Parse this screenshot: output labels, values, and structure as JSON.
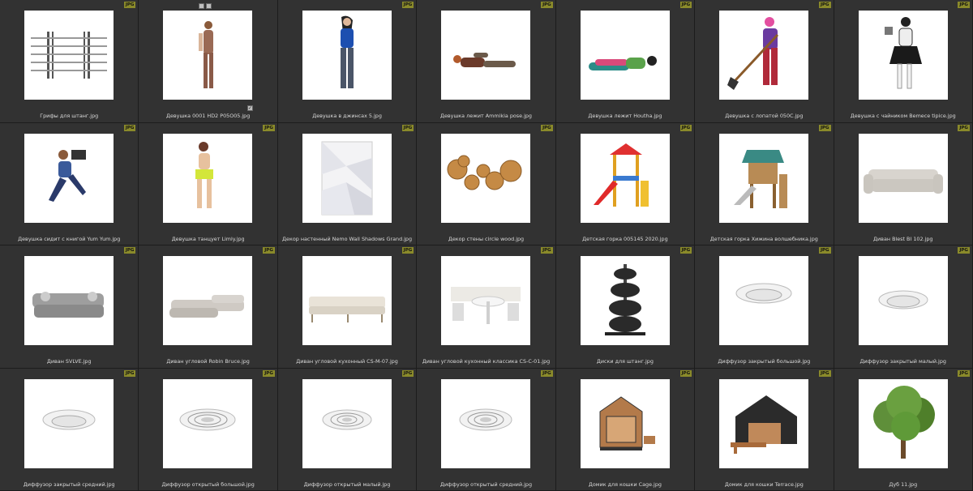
{
  "badge": "JPG",
  "items": [
    {
      "caption": "Грифы для штанг.jpg",
      "icon": "barbell-bars-thumbnail"
    },
    {
      "caption": "Девушка 0001 HD2 P05O05.jpg",
      "icon": "woman-standing-thumbnail"
    },
    {
      "caption": "Девушка в джинсах 5.jpg",
      "icon": "woman-jeans-thumbnail"
    },
    {
      "caption": "Девушка лежит Ammikia pose.jpg",
      "icon": "woman-lying-thumbnail"
    },
    {
      "caption": "Девушка лежит Houtha.jpg",
      "icon": "woman-lying-dress-thumbnail"
    },
    {
      "caption": "Девушка с лопатой 050C.jpg",
      "icon": "woman-shovel-thumbnail"
    },
    {
      "caption": "Девушка с чайником Bemece tipice.jpg",
      "icon": "woman-teapot-thumbnail"
    },
    {
      "caption": "Девушка сидит с книгой Yum Yum.jpg",
      "icon": "woman-book-thumbnail"
    },
    {
      "caption": "Девушка танцует Limly.jpg",
      "icon": "woman-dancing-thumbnail"
    },
    {
      "caption": "Декор настенный Nemo Wall Shadows Grand.jpg",
      "icon": "wall-panel-thumbnail"
    },
    {
      "caption": "Декор стены circle wood.jpg",
      "icon": "wood-circles-thumbnail"
    },
    {
      "caption": "Детская горка 005145 2020.jpg",
      "icon": "kids-slide-thumbnail"
    },
    {
      "caption": "Детская горка Хижина волшебника.jpg",
      "icon": "playhouse-slide-thumbnail"
    },
    {
      "caption": "Диван Blest BI 102.jpg",
      "icon": "sofa-thumbnail"
    },
    {
      "caption": "Диван SVLVE.jpg",
      "icon": "sofa-grey-thumbnail"
    },
    {
      "caption": "Диван угловой Robin Bruce.jpg",
      "icon": "corner-sofa-thumbnail"
    },
    {
      "caption": "Диван угловой кухонный CS-M-07.jpg",
      "icon": "kitchen-corner-sofa-thumbnail"
    },
    {
      "caption": "Диван угловой кухонный классика CS-C-01.jpg",
      "icon": "kitchen-set-thumbnail"
    },
    {
      "caption": "Диски для штанг.jpg",
      "icon": "weight-plates-thumbnail"
    },
    {
      "caption": "Диффузор закрытый большой.jpg",
      "icon": "diffuser-closed-large-thumbnail"
    },
    {
      "caption": "Диффузор закрытый малый.jpg",
      "icon": "diffuser-closed-small-thumbnail"
    },
    {
      "caption": "Диффузор закрытый средний.jpg",
      "icon": "diffuser-closed-medium-thumbnail"
    },
    {
      "caption": "Диффузор открытый большой.jpg",
      "icon": "diffuser-open-large-thumbnail"
    },
    {
      "caption": "Диффузор открытый малый.jpg",
      "icon": "diffuser-open-small-thumbnail"
    },
    {
      "caption": "Диффузор открытый средний.jpg",
      "icon": "diffuser-open-medium-thumbnail"
    },
    {
      "caption": "Домик для кошки Cage.jpg",
      "icon": "cat-house-cage-thumbnail"
    },
    {
      "caption": "Домик для кошки Terrace.jpg",
      "icon": "cat-house-terrace-thumbnail"
    },
    {
      "caption": "Дуб 11.jpg",
      "icon": "oak-tree-thumbnail"
    }
  ]
}
